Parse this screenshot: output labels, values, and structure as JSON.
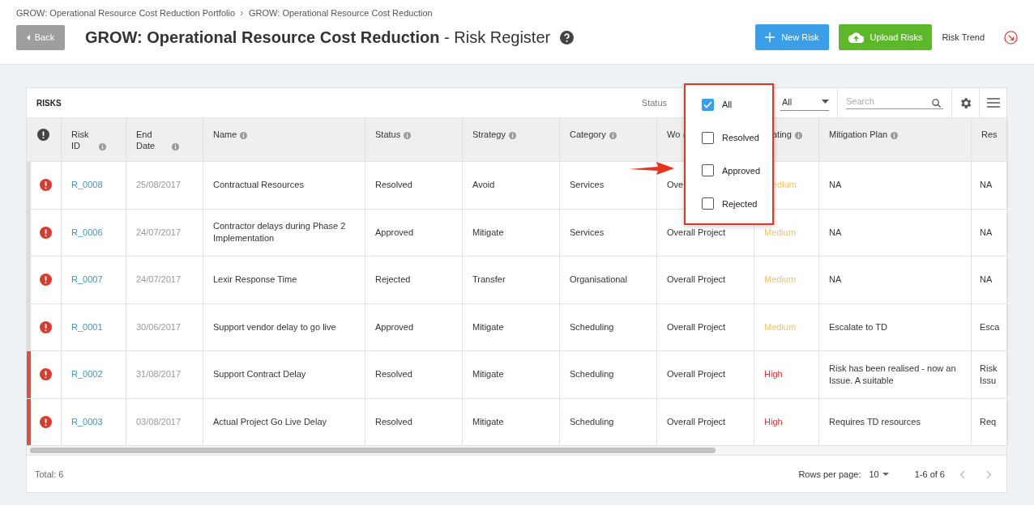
{
  "breadcrumb": [
    "GROW: Operational Resource Cost Reduction Portfolio",
    "GROW: Operational Resource Cost Reduction"
  ],
  "back_button": "Back",
  "title": "**GROW: Operational Resource Cost Reduction** - Risk Register",
  "actions": [
    {
      "kind": "primary",
      "label": "New Risk"
    },
    {
      "kind": "success",
      "label": "Upload Risks"
    },
    {
      "kind": "link",
      "label": "Risk Trend"
    }
  ],
  "card": {
    "title": "RISKS",
    "status_filter_label": "Status",
    "rating_filter_value": "All",
    "search": {
      "placeholder": "Search"
    }
  },
  "status_menu": [
    {
      "label": "All",
      "checked": true
    },
    {
      "label": "Resolved",
      "checked": false
    },
    {
      "label": "Approved",
      "checked": false
    },
    {
      "label": "Rejected",
      "checked": false
    }
  ],
  "columns": [
    {
      "kind": "alert"
    },
    {
      "kind": "text",
      "label": "Risk ID",
      "covered": false
    },
    {
      "kind": "text",
      "label": "End Date",
      "covered": false
    },
    {
      "kind": "text",
      "label": "Name",
      "covered": false
    },
    {
      "kind": "text",
      "label": "Status",
      "covered": false
    },
    {
      "kind": "text",
      "label": "Strategy",
      "covered": false
    },
    {
      "kind": "text",
      "label": "Category",
      "covered": false
    },
    {
      "kind": "text",
      "label": "Wo",
      "covered": false
    },
    {
      "kind": "text",
      "label": "ating",
      "covered": true
    },
    {
      "kind": "text",
      "label": "Mitigation Plan",
      "covered": false
    },
    {
      "kind": "cut",
      "label": "Res"
    }
  ],
  "rows": [
    {
      "flagged": false,
      "covered": true,
      "id": "R_0008",
      "end_date": "25/08/2017",
      "name": "Contractual Resources",
      "status": "Resolved",
      "strategy": "Avoid",
      "category": "Services",
      "work": "Ove",
      "rating": {
        "text": "edium",
        "color": "#f2c469"
      },
      "mitigation": "NA",
      "res": "NA"
    },
    {
      "flagged": false,
      "covered": false,
      "id": "R_0006",
      "end_date": "24/07/2017",
      "name": "Contractor delays during Phase 2 Implementation",
      "status": "Approved",
      "strategy": "Mitigate",
      "category": "Services",
      "work": "Overall Project",
      "rating": {
        "text": "Medium",
        "color": "#f2c469"
      },
      "mitigation": "NA",
      "res": "NA"
    },
    {
      "flagged": false,
      "covered": false,
      "id": "R_0007",
      "end_date": "24/07/2017",
      "name": "Lexir Response Time",
      "status": "Rejected",
      "strategy": "Transfer",
      "category": "Organisational",
      "work": "Overall Project",
      "rating": {
        "text": "Medium",
        "color": "#f2c469"
      },
      "mitigation": "NA",
      "res": "NA"
    },
    {
      "flagged": false,
      "covered": false,
      "id": "R_0001",
      "end_date": "30/06/2017",
      "name": "Support vendor delay to go live",
      "status": "Approved",
      "strategy": "Mitigate",
      "category": "Scheduling",
      "work": "Overall Project",
      "rating": {
        "text": "Medium",
        "color": "#f2c469"
      },
      "mitigation": "Escalate to TD",
      "res": "Esca"
    },
    {
      "flagged": true,
      "covered": false,
      "id": "R_0002",
      "end_date": "31/08/2017",
      "name": "Support Contract Delay",
      "status": "Resolved",
      "strategy": "Mitigate",
      "category": "Scheduling",
      "work": "Overall Project",
      "rating": {
        "text": "High",
        "color": "#d9393a"
      },
      "mitigation": "Risk has been realised - now an Issue. A suitable",
      "res": "Risk Issu"
    },
    {
      "flagged": true,
      "covered": false,
      "id": "R_0003",
      "end_date": "03/08/2017",
      "name": "Actual Project Go Live Delay",
      "status": "Resolved",
      "strategy": "Mitigate",
      "category": "Scheduling",
      "work": "Overall Project",
      "rating": {
        "text": "High",
        "color": "#d9393a"
      },
      "mitigation": "Requires TD resources",
      "res": "Req"
    }
  ],
  "footer": {
    "total": "Total: 6",
    "rows_per_page_label": "Rows per page:",
    "rows_per_page": "10",
    "range": "1-6 of 6"
  }
}
